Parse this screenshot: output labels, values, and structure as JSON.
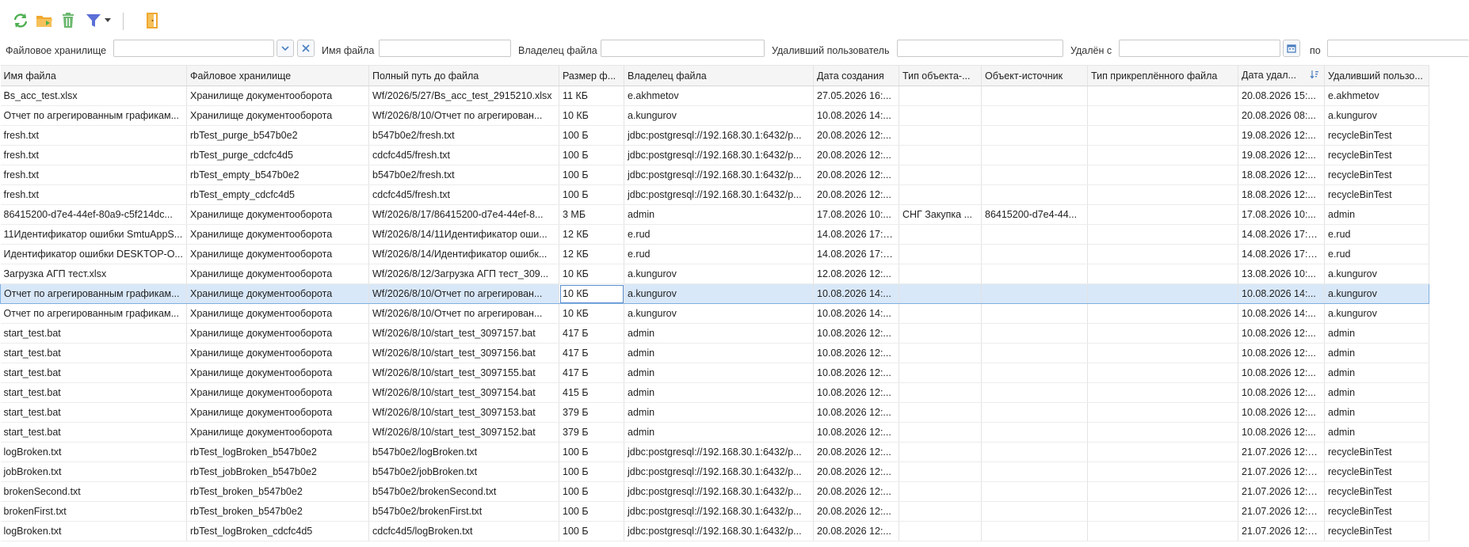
{
  "toolbar": {
    "icons": [
      "refresh-icon",
      "restore-folder-icon",
      "delete-icon",
      "filter-icon",
      "dropdown-arrow-icon",
      "exit-door-icon"
    ]
  },
  "filters": {
    "storage_label": "Файловое хранилище",
    "filename_label": "Имя файла",
    "owner_label": "Владелец файла",
    "deleter_label": "Удаливший пользователь",
    "deleted_from_label": "Удалён с",
    "deleted_to_label": "по"
  },
  "columns": [
    "Имя файла",
    "Файловое хранилище",
    "Полный путь до файла",
    "Размер ф...",
    "Владелец файла",
    "Дата создания",
    "Тип объекта-...",
    "Объект-источник",
    "Тип прикреплённого файла",
    "Дата удал...",
    "Удаливший пользо..."
  ],
  "rows": [
    [
      "Bs_acc_test.xlsx",
      "Хранилище документооборота",
      "Wf/2026/5/27/Bs_acc_test_2915210.xlsx",
      "11 КБ",
      "e.akhmetov",
      "27.05.2026 16:...",
      "",
      "",
      "",
      "20.08.2026 15:...",
      "e.akhmetov"
    ],
    [
      "Отчет по агрегированным графикам...",
      "Хранилище документооборота",
      "Wf/2026/8/10/Отчет по агрегирован...",
      "10 КБ",
      "a.kungurov",
      "10.08.2026 14:...",
      "",
      "",
      "",
      "20.08.2026 08:...",
      "a.kungurov"
    ],
    [
      "fresh.txt",
      "rbTest_purge_b547b0e2",
      "b547b0e2/fresh.txt",
      "100 Б",
      "jdbc:postgresql://192.168.30.1:6432/p...",
      "20.08.2026 12:...",
      "",
      "",
      "",
      "19.08.2026 12:...",
      "recycleBinTest"
    ],
    [
      "fresh.txt",
      "rbTest_purge_cdcfc4d5",
      "cdcfc4d5/fresh.txt",
      "100 Б",
      "jdbc:postgresql://192.168.30.1:6432/p...",
      "20.08.2026 12:...",
      "",
      "",
      "",
      "19.08.2026 12:...",
      "recycleBinTest"
    ],
    [
      "fresh.txt",
      "rbTest_empty_b547b0e2",
      "b547b0e2/fresh.txt",
      "100 Б",
      "jdbc:postgresql://192.168.30.1:6432/p...",
      "20.08.2026 12:...",
      "",
      "",
      "",
      "18.08.2026 12:...",
      "recycleBinTest"
    ],
    [
      "fresh.txt",
      "rbTest_empty_cdcfc4d5",
      "cdcfc4d5/fresh.txt",
      "100 Б",
      "jdbc:postgresql://192.168.30.1:6432/p...",
      "20.08.2026 12:...",
      "",
      "",
      "",
      "18.08.2026 12:...",
      "recycleBinTest"
    ],
    [
      "86415200-d7e4-44ef-80a9-c5f214dc...",
      "Хранилище документооборота",
      "Wf/2026/8/17/86415200-d7e4-44ef-8...",
      "3 МБ",
      "admin",
      "17.08.2026 10:...",
      "СНГ Закупка ...",
      "86415200-d7e4-44...",
      "",
      "17.08.2026 10:...",
      "admin"
    ],
    [
      "11Идентификатор ошибки SmtuAppS...",
      "Хранилище документооборота",
      "Wf/2026/8/14/11Идентификатор оши...",
      "12 КБ",
      "e.rud",
      "14.08.2026 17:1...",
      "",
      "",
      "",
      "14.08.2026 17:1...",
      "e.rud"
    ],
    [
      "Идентификатор ошибки DESKTOP-O...",
      "Хранилище документооборота",
      "Wf/2026/8/14/Идентификатор ошибк...",
      "12 КБ",
      "e.rud",
      "14.08.2026 17:1...",
      "",
      "",
      "",
      "14.08.2026 17:1...",
      "e.rud"
    ],
    [
      "Загрузка АГП тест.xlsx",
      "Хранилище документооборота",
      "Wf/2026/8/12/Загрузка АГП тест_309...",
      "10 КБ",
      "a.kungurov",
      "12.08.2026 12:...",
      "",
      "",
      "",
      "13.08.2026 10:...",
      "a.kungurov"
    ],
    [
      "Отчет по агрегированным графикам...",
      "Хранилище документооборота",
      "Wf/2026/8/10/Отчет по агрегирован...",
      "10 КБ",
      "a.kungurov",
      "10.08.2026 14:...",
      "",
      "",
      "",
      "10.08.2026 14:...",
      "a.kungurov"
    ],
    [
      "Отчет по агрегированным графикам...",
      "Хранилище документооборота",
      "Wf/2026/8/10/Отчет по агрегирован...",
      "10 КБ",
      "a.kungurov",
      "10.08.2026 14:...",
      "",
      "",
      "",
      "10.08.2026 14:...",
      "a.kungurov"
    ],
    [
      "start_test.bat",
      "Хранилище документооборота",
      "Wf/2026/8/10/start_test_3097157.bat",
      "417 Б",
      "admin",
      "10.08.2026 12:...",
      "",
      "",
      "",
      "10.08.2026 12:...",
      "admin"
    ],
    [
      "start_test.bat",
      "Хранилище документооборота",
      "Wf/2026/8/10/start_test_3097156.bat",
      "417 Б",
      "admin",
      "10.08.2026 12:...",
      "",
      "",
      "",
      "10.08.2026 12:...",
      "admin"
    ],
    [
      "start_test.bat",
      "Хранилище документооборота",
      "Wf/2026/8/10/start_test_3097155.bat",
      "417 Б",
      "admin",
      "10.08.2026 12:...",
      "",
      "",
      "",
      "10.08.2026 12:...",
      "admin"
    ],
    [
      "start_test.bat",
      "Хранилище документооборота",
      "Wf/2026/8/10/start_test_3097154.bat",
      "415 Б",
      "admin",
      "10.08.2026 12:...",
      "",
      "",
      "",
      "10.08.2026 12:...",
      "admin"
    ],
    [
      "start_test.bat",
      "Хранилище документооборота",
      "Wf/2026/8/10/start_test_3097153.bat",
      "379 Б",
      "admin",
      "10.08.2026 12:...",
      "",
      "",
      "",
      "10.08.2026 12:...",
      "admin"
    ],
    [
      "start_test.bat",
      "Хранилище документооборота",
      "Wf/2026/8/10/start_test_3097152.bat",
      "379 Б",
      "admin",
      "10.08.2026 12:...",
      "",
      "",
      "",
      "10.08.2026 12:...",
      "admin"
    ],
    [
      "logBroken.txt",
      "rbTest_logBroken_b547b0e2",
      "b547b0e2/logBroken.txt",
      "100 Б",
      "jdbc:postgresql://192.168.30.1:6432/p...",
      "20.08.2026 12:...",
      "",
      "",
      "",
      "21.07.2026 12:1...",
      "recycleBinTest"
    ],
    [
      "jobBroken.txt",
      "rbTest_jobBroken_b547b0e2",
      "b547b0e2/jobBroken.txt",
      "100 Б",
      "jdbc:postgresql://192.168.30.1:6432/p...",
      "20.08.2026 12:...",
      "",
      "",
      "",
      "21.07.2026 12:1...",
      "recycleBinTest"
    ],
    [
      "brokenSecond.txt",
      "rbTest_broken_b547b0e2",
      "b547b0e2/brokenSecond.txt",
      "100 Б",
      "jdbc:postgresql://192.168.30.1:6432/p...",
      "20.08.2026 12:...",
      "",
      "",
      "",
      "21.07.2026 12:1...",
      "recycleBinTest"
    ],
    [
      "brokenFirst.txt",
      "rbTest_broken_b547b0e2",
      "b547b0e2/brokenFirst.txt",
      "100 Б",
      "jdbc:postgresql://192.168.30.1:6432/p...",
      "20.08.2026 12:...",
      "",
      "",
      "",
      "21.07.2026 12:1...",
      "recycleBinTest"
    ],
    [
      "logBroken.txt",
      "rbTest_logBroken_cdcfc4d5",
      "cdcfc4d5/logBroken.txt",
      "100 Б",
      "jdbc:postgresql://192.168.30.1:6432/p...",
      "20.08.2026 12:...",
      "",
      "",
      "",
      "21.07.2026 12:1...",
      "recycleBinTest"
    ]
  ],
  "selected_row": 10,
  "colors": {
    "accent": "#5a8fd0",
    "selection": "#d9e8f8",
    "refresh": "#4caf50",
    "folder": "#f0a830",
    "filter": "#5b6fd6",
    "exit": "#f0a830"
  }
}
